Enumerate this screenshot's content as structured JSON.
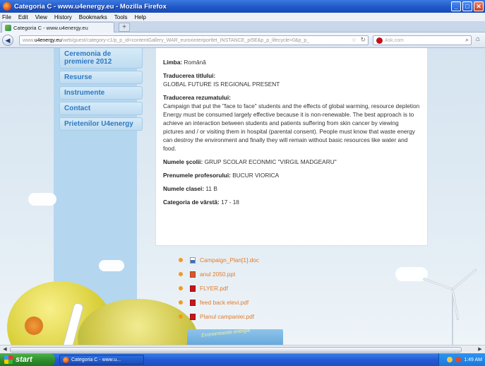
{
  "window": {
    "title": "Categoria C - www.u4energy.eu - Mozilla Firefox",
    "controls": {
      "minimize": "_",
      "maximize": "□",
      "close": "✕"
    }
  },
  "menu": [
    "File",
    "Edit",
    "View",
    "History",
    "Bookmarks",
    "Tools",
    "Help"
  ],
  "tab": {
    "label": "Categoria C - www.u4energy.eu",
    "new_tab": "+"
  },
  "nav": {
    "url_prefix": "www.",
    "url_domain": "u4energy.eu",
    "url_rest": "/web/guest/category-c1/p_p_id=contentGallery_WAR_euroxinteriportlet_INSTANCE_pI5E&p_p_lifecycle=0&p_p_",
    "search_placeholder": "Ask.com"
  },
  "sidebar": {
    "items": [
      {
        "label": "Ceremonia de premiere 2012"
      },
      {
        "label": "Resurse"
      },
      {
        "label": "Instrumente"
      },
      {
        "label": "Contact"
      },
      {
        "label": "Prietenilor U4energy"
      }
    ]
  },
  "details": {
    "limba_label": "Limba:",
    "limba_value": "Română",
    "traducere_titlu_label": "Traducerea titlului:",
    "traducere_titlu_value": "GLOBAL FUTURE IS REGIONAL PRESENT",
    "traducere_rezumat_label": "Traducerea rezumatului:",
    "traducere_rezumat_value": "Campaign that put the \"face to face\" students and the effects of global warming, resource depletion Energy must be consumed largely effective because it is non-renewable. The best approach is to achieve an interaction between students and patients suffering from skin cancer by viewing pictures and / or visiting them in hospital (parental consent). People must know that waste energy can destroy the environment and finally they will remain without basic resources like water and food.",
    "scoala_label": "Numele şcolii:",
    "scoala_value": "GRUP SCOLAR ECONMIC \"VIRGIL MADGEARU\"",
    "profesor_label": "Prenumele profesorului:",
    "profesor_value": "BUCUR VIORICA",
    "clasa_label": "Numele clasei:",
    "clasa_value": "11 B",
    "varsta_label": "Categoria de vârstă:",
    "varsta_value": "17 - 18"
  },
  "attachments": [
    {
      "name": "Campaign_Plan[1].doc",
      "icon": "doc"
    },
    {
      "name": "anul 2050.ppt",
      "icon": "ppt"
    },
    {
      "name": "FLYER.pdf",
      "icon": "pdf"
    },
    {
      "name": "feed back elevi.pdf",
      "icon": "pdf"
    },
    {
      "name": "Planul campaniei.pdf",
      "icon": "pdf"
    }
  ],
  "banner": {
    "text": "Economiseste energia"
  },
  "taskbar": {
    "start_label": "start",
    "item_label": "Categoria C - www.u...",
    "clock": "1:49 AM"
  },
  "colors": {
    "link": "#e07b2c",
    "nav_text": "#2f78c2",
    "xp_blue": "#245ad6"
  }
}
